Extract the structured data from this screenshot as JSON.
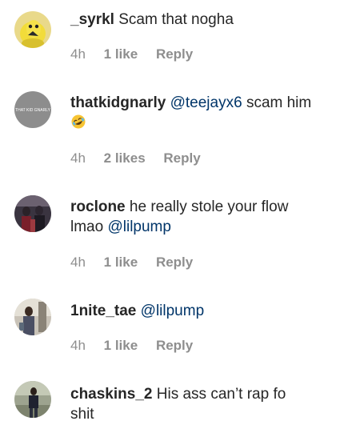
{
  "comments": [
    {
      "username": "_syrkl",
      "text": "Scam that nogha",
      "time": "4h",
      "likes": "1 like",
      "reply": "Reply",
      "avatar_icon": "yellow-cartoon-avatar"
    },
    {
      "username": "thatkidgnarly",
      "mention": "@teejayx6",
      "text": "scam him",
      "emoji_icon": "rolling-on-floor-laughing-emoji",
      "time": "4h",
      "likes": "2 likes",
      "reply": "Reply",
      "avatar_icon": "gray-text-avatar",
      "avatar_text": "THAT KID GNARLY"
    },
    {
      "username": "roclone",
      "text_line1": "he really stole your flow",
      "text_line2": "lmao",
      "mention": "@lilpump",
      "time": "4h",
      "likes": "1 like",
      "reply": "Reply",
      "avatar_icon": "photo-avatar"
    },
    {
      "username": "1nite_tae",
      "mention": "@lilpump",
      "time": "4h",
      "likes": "1 like",
      "reply": "Reply",
      "avatar_icon": "photo-avatar"
    },
    {
      "username": "chaskins_2",
      "text_line1": "His ass can’t rap fo",
      "text_line2": "shit",
      "avatar_icon": "photo-avatar"
    }
  ],
  "colors": {
    "text": "#262626",
    "meta": "#8e8e8e",
    "mention": "#003569"
  }
}
